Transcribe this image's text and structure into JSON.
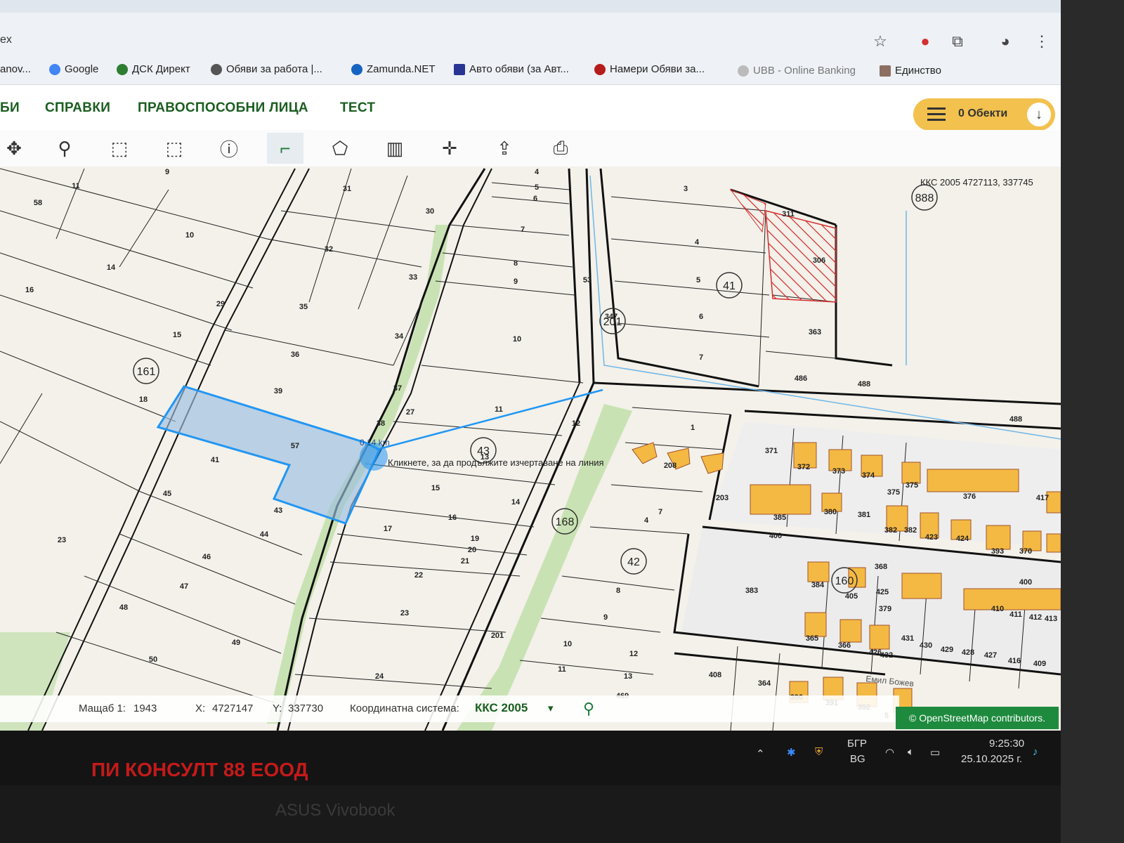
{
  "browser": {
    "address_fragment": "ex",
    "bookmarks": [
      {
        "label": "anov..."
      },
      {
        "label": "Google"
      },
      {
        "label": "ДСК Директ"
      },
      {
        "label": "Обяви за работа |..."
      },
      {
        "label": "Zamunda.NET"
      },
      {
        "label": "Авто обяви (за Авт..."
      },
      {
        "label": "Намери Обяви за..."
      },
      {
        "label": "UBB - Online Banking"
      },
      {
        "label": "Единство"
      }
    ]
  },
  "nav": {
    "items": [
      "БИ",
      "СПРАВКИ",
      "ПРАВОСПОСОБНИ ЛИЦА",
      "ТЕСТ"
    ],
    "objects_label": "0 Обекти"
  },
  "map": {
    "top_coord": "ККС 2005 4727113, 337745",
    "distance_label": "0.14 km",
    "tooltip": "Кликнете, за да продължите изчертаване на линия",
    "attribution": "© OpenStreetMap contributors.",
    "street_name": "Емил Божев",
    "circled_labels": [
      "888",
      "41",
      "201",
      "161",
      "43",
      "168",
      "42",
      "160"
    ],
    "parcel_labels": [
      "9",
      "11",
      "58",
      "10",
      "14",
      "16",
      "31",
      "30",
      "32",
      "33",
      "35",
      "36",
      "39",
      "57",
      "41",
      "45",
      "23",
      "46",
      "47",
      "48",
      "50",
      "49",
      "44",
      "43",
      "18",
      "15",
      "34",
      "37",
      "38",
      "27",
      "17",
      "22",
      "23",
      "24",
      "4",
      "5",
      "6",
      "7",
      "8",
      "9",
      "10",
      "11",
      "12",
      "13",
      "14",
      "15",
      "16",
      "19",
      "20",
      "21",
      "3",
      "4",
      "5",
      "6",
      "7",
      "311",
      "306",
      "363",
      "486",
      "488",
      "488",
      "1",
      "208",
      "203",
      "371",
      "372",
      "373",
      "374",
      "375",
      "375",
      "376",
      "417",
      "385",
      "380",
      "381",
      "382",
      "382",
      "423",
      "424",
      "393",
      "370",
      "400",
      "383",
      "384",
      "405",
      "368",
      "425",
      "379",
      "400",
      "410",
      "411",
      "412",
      "413",
      "365",
      "366",
      "426",
      "432",
      "431",
      "430",
      "429",
      "428",
      "427",
      "416",
      "409",
      "408",
      "364",
      "390",
      "391",
      "392",
      "5",
      "4",
      "7",
      "8",
      "9",
      "10",
      "11",
      "12",
      "13",
      "469",
      "201",
      "347",
      "53",
      "29"
    ]
  },
  "status": {
    "scale_label": "Мащаб 1:",
    "scale_value": "1943",
    "x_label": "X:",
    "x_value": "4727147",
    "y_label": "Y:",
    "y_value": "337730",
    "crs_label": "Координатна система:",
    "crs_value": "ККС 2005"
  },
  "taskbar": {
    "lang_top": "БГР",
    "lang_bottom": "BG",
    "time": "9:25:30",
    "date": "25.10.2025 г."
  },
  "overlay": {
    "brand": "ПИ КОНСУЛТ 88 ЕООД",
    "laptop": "ASUS Vivobook"
  },
  "colors": {
    "nav_green": "#1b5e20",
    "objects_yellow": "#f2c14e",
    "selection_blue": "#2196f3",
    "building_orange": "#f4b942",
    "hatch_red": "#d32f2f",
    "green_strip": "#b7d99a"
  }
}
